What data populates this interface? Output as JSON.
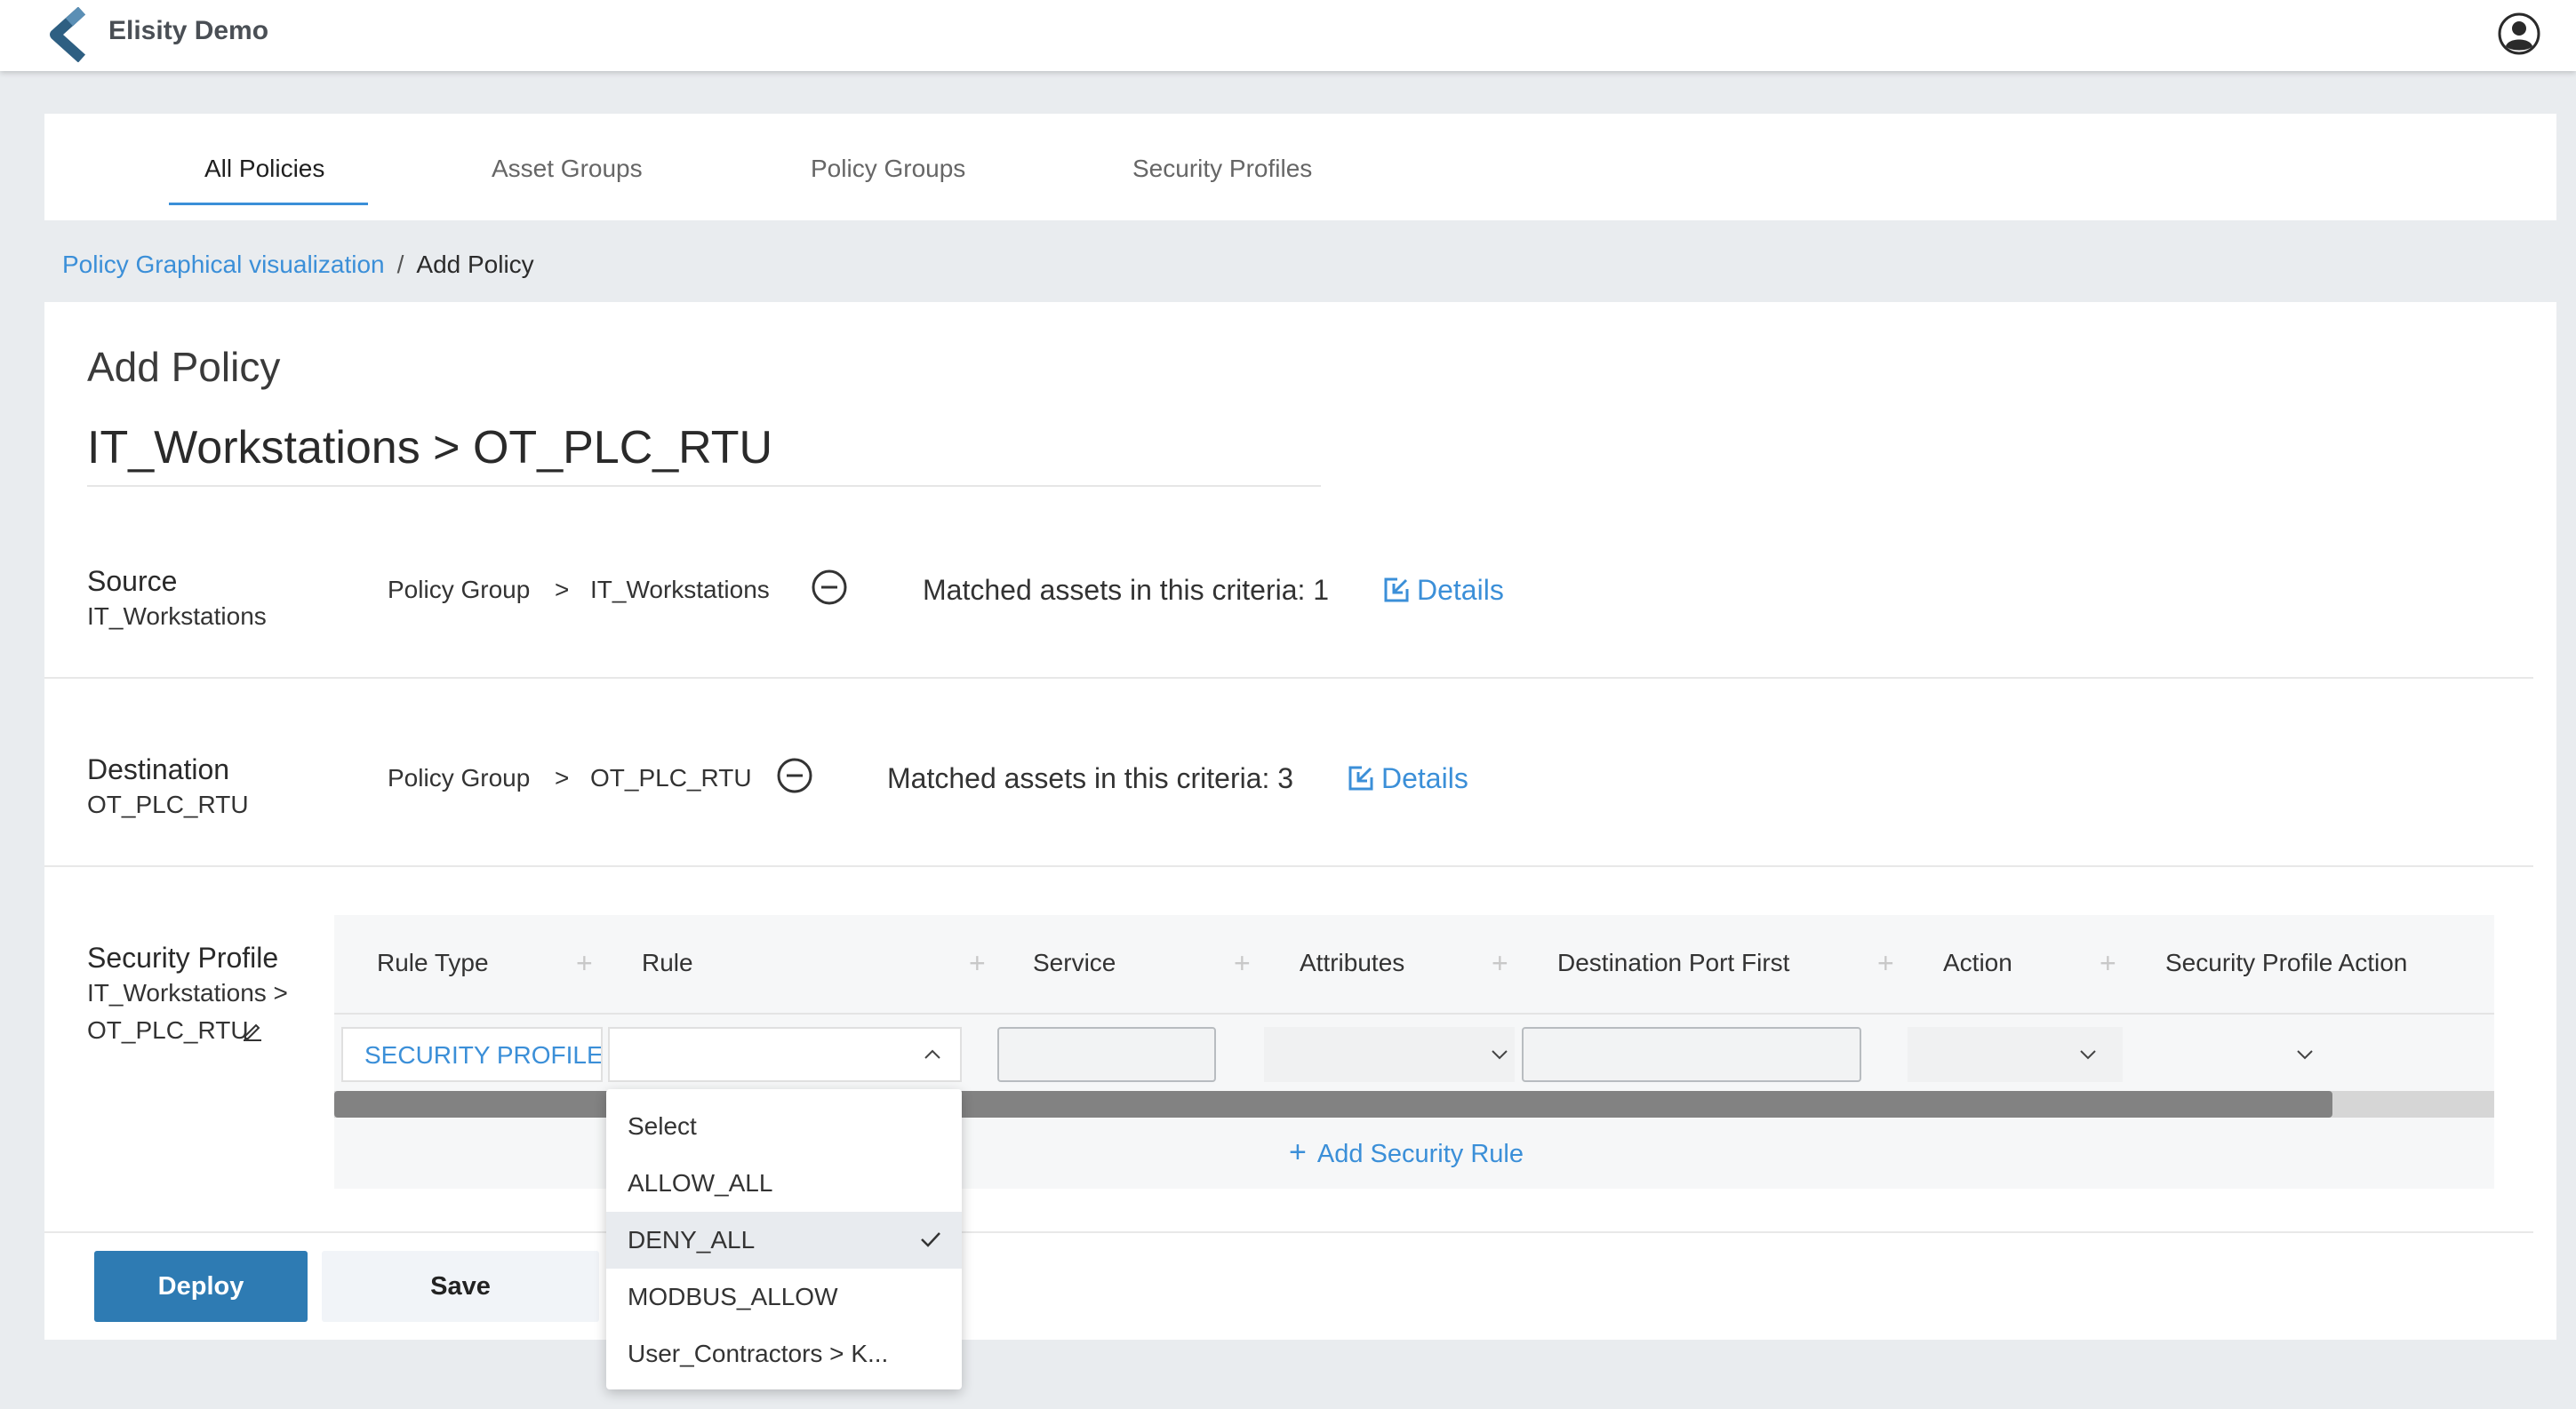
{
  "app": {
    "title": "Elisity Demo"
  },
  "tabs": [
    {
      "label": "All Policies",
      "active": true
    },
    {
      "label": "Asset Groups",
      "active": false
    },
    {
      "label": "Policy Groups",
      "active": false
    },
    {
      "label": "Security Profiles",
      "active": false
    }
  ],
  "breadcrumb": {
    "link": "Policy Graphical visualization",
    "separator": "/",
    "current": "Add Policy"
  },
  "page": {
    "heading": "Add Policy",
    "policy_name": "IT_Workstations > OT_PLC_RTU"
  },
  "source": {
    "label": "Source",
    "sub": "IT_Workstations",
    "group_type": "Policy Group",
    "arrow": ">",
    "group_name": "IT_Workstations",
    "matched": "Matched assets in this criteria: 1",
    "details": "Details"
  },
  "destination": {
    "label": "Destination",
    "sub": "OT_PLC_RTU",
    "group_type": "Policy Group",
    "arrow": ">",
    "group_name": "OT_PLC_RTU",
    "matched": "Matched assets in this criteria: 3",
    "details": "Details"
  },
  "security_profile": {
    "label": "Security Profile",
    "sub_line1": "IT_Workstations >",
    "sub_line2": "OT_PLC_RTU"
  },
  "table": {
    "columns": [
      "Rule Type",
      "Rule",
      "Service",
      "Attributes",
      "Destination Port First",
      "Action",
      "Security Profile Action"
    ],
    "row": {
      "rule_type": "SECURITY PROFILE",
      "rule": "",
      "service": "",
      "attributes": "",
      "destination_port": "",
      "action": ""
    },
    "add_rule": "Add Security Rule"
  },
  "buttons": {
    "deploy": "Deploy",
    "save": "Save"
  },
  "dropdown": {
    "options": [
      "Select",
      "ALLOW_ALL",
      "DENY_ALL",
      "MODBUS_ALLOW",
      "User_Contractors > K..."
    ],
    "selected": "DENY_ALL"
  },
  "colors": {
    "accent": "#3b8fd8",
    "primary_button": "#2e7bb3",
    "logo": "#2e5f82"
  }
}
